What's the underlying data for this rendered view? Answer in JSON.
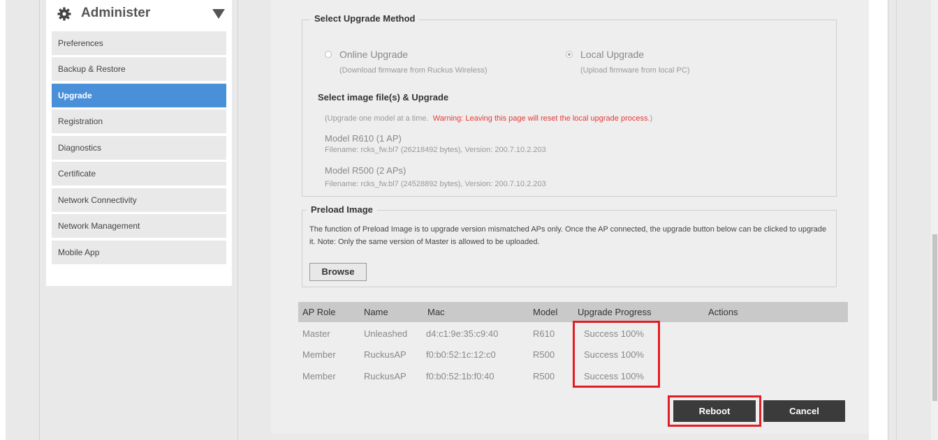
{
  "sidebar": {
    "title": "Administer",
    "items": [
      {
        "label": "Preferences",
        "active": false
      },
      {
        "label": "Backup & Restore",
        "active": false
      },
      {
        "label": "Upgrade",
        "active": true
      },
      {
        "label": "Registration",
        "active": false
      },
      {
        "label": "Diagnostics",
        "active": false
      },
      {
        "label": "Certificate",
        "active": false
      },
      {
        "label": "Network Connectivity",
        "active": false
      },
      {
        "label": "Network Management",
        "active": false
      },
      {
        "label": "Mobile App",
        "active": false
      }
    ]
  },
  "upgrade_method": {
    "legend": "Select Upgrade Method",
    "online": {
      "label": "Online Upgrade",
      "sub": "(Download firmware from Ruckus Wireless)",
      "selected": false
    },
    "local": {
      "label": "Local Upgrade",
      "sub": "(Upload firmware from local PC)",
      "selected": true
    },
    "image_title": "Select image file(s) & Upgrade",
    "note_prefix": "(Upgrade one model at a time.",
    "note_warning": "Warning: Leaving this page will reset the local upgrade process.",
    "note_suffix": ")",
    "models": [
      {
        "title": "Model R610 (1 AP)",
        "file": "Filename: rcks_fw.bl7 (26218492 bytes), Version: 200.7.10.2.203"
      },
      {
        "title": "Model R500 (2 APs)",
        "file": "Filename: rcks_fw.bl7 (24528892 bytes), Version: 200.7.10.2.203"
      }
    ]
  },
  "preload": {
    "legend": "Preload Image",
    "text": "The function of Preload Image is to upgrade version mismatched APs only. Once the AP connected, the upgrade button below can be clicked to upgrade it. Note: Only the same version of Master is allowed to be uploaded.",
    "browse_label": "Browse"
  },
  "table": {
    "headers": [
      "AP Role",
      "Name",
      "Mac",
      "Model",
      "Upgrade Progress",
      "Actions"
    ],
    "rows": [
      [
        "Master",
        "Unleashed",
        "d4:c1:9e:35:c9:40",
        "R610",
        "Success 100%",
        ""
      ],
      [
        "Member",
        "RuckusAP",
        "f0:b0:52:1c:12:c0",
        "R500",
        "Success 100%",
        ""
      ],
      [
        "Member",
        "RuckusAP",
        "f0:b0:52:1b:f0:40",
        "R500",
        "Success 100%",
        ""
      ]
    ]
  },
  "actions": {
    "reboot_label": "Reboot",
    "cancel_label": "Cancel"
  },
  "colors": {
    "accent": "#4a90d9",
    "highlight": "#e51c23",
    "warning": "#e53935",
    "button_dark": "#3b3b3b"
  }
}
